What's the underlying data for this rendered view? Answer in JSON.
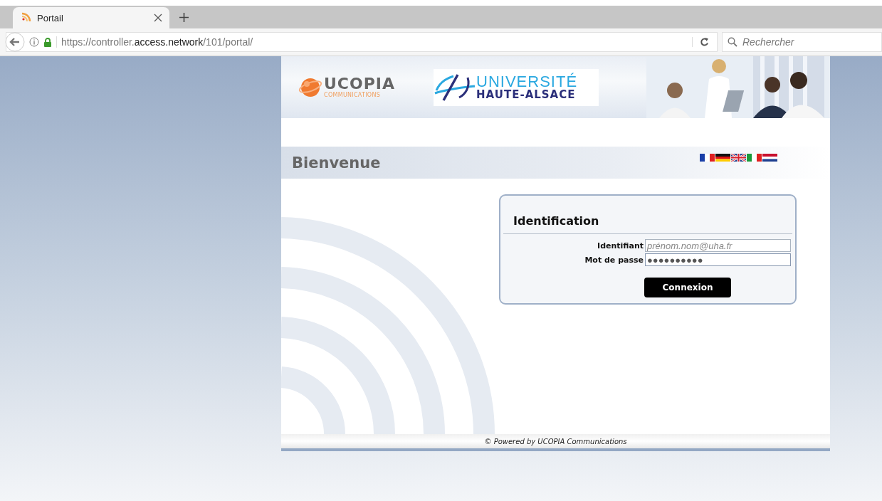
{
  "browser": {
    "tab": {
      "title": "Portail",
      "selected": true
    },
    "url": "https://controller.**access.network**/101/portal/",
    "search": {
      "placeholder": "Rechercher"
    }
  },
  "header": {
    "brand": {
      "name": "UCOPIA",
      "tagline": "COMMUNICATIONS"
    },
    "university": {
      "line1": "UNIVERSITÉ",
      "line2": "HAUTE-ALSACE"
    }
  },
  "welcome": {
    "title": "Bienvenue"
  },
  "login": {
    "title": "Identification",
    "fields": [
      {
        "label": "Identifiant",
        "placeholder": "prénom.nom@uha.fr",
        "focused": false
      },
      {
        "label": "Mot de passe",
        "value": "●●●●●●●●●●",
        "focused": true
      }
    ],
    "submit": "Connexion"
  },
  "footer": "© Powered by UCOPIA Communications"
}
